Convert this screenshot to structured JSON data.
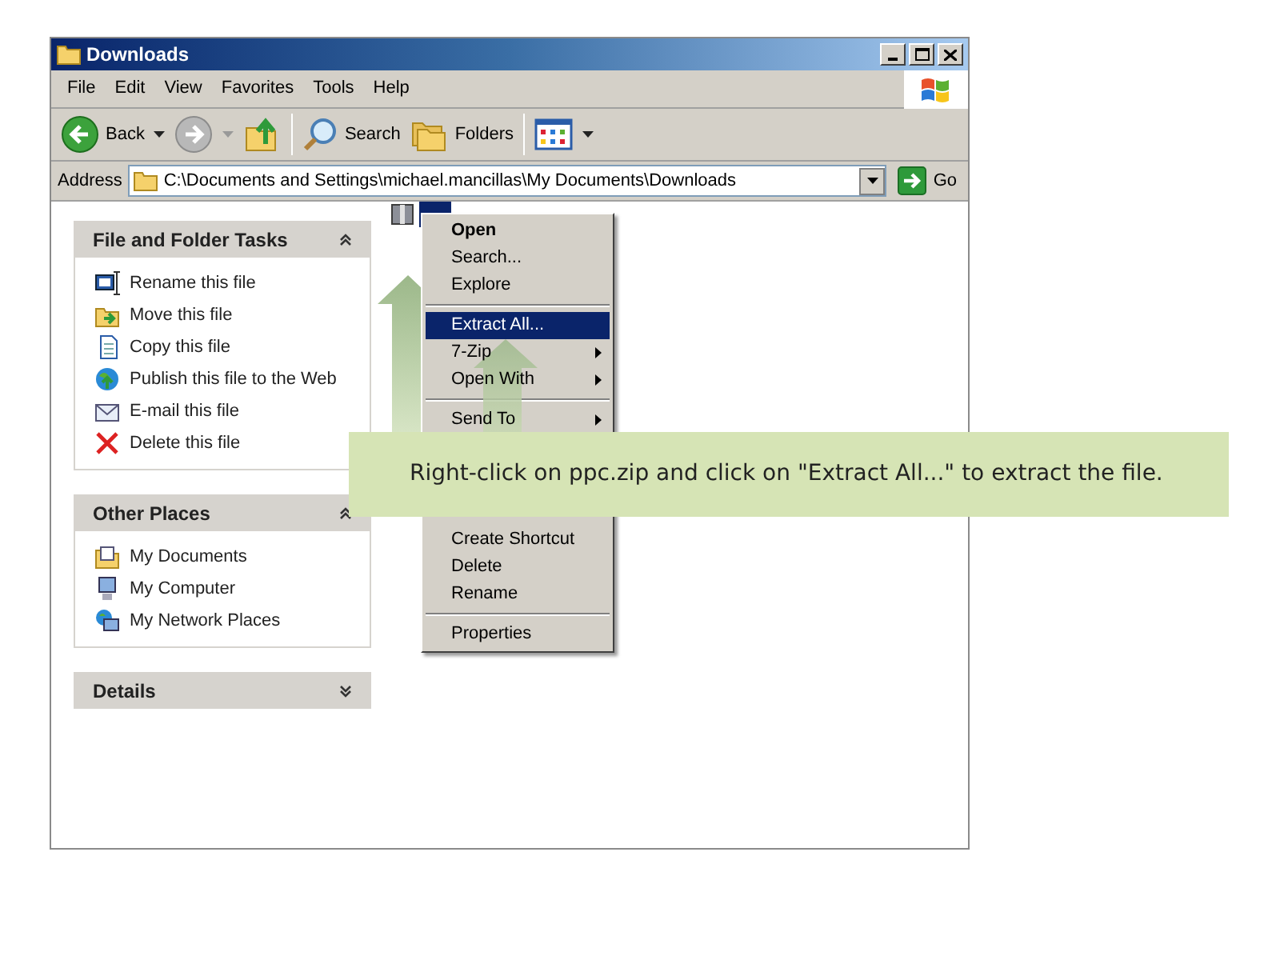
{
  "window": {
    "title": "Downloads"
  },
  "menu_bar": [
    "File",
    "Edit",
    "View",
    "Favorites",
    "Tools",
    "Help"
  ],
  "toolbar": [
    {
      "kind": "back",
      "label": "Back"
    },
    {
      "kind": "forward"
    },
    {
      "kind": "up"
    },
    {
      "kind": "search",
      "label": "Search"
    },
    {
      "kind": "folders",
      "label": "Folders"
    },
    {
      "kind": "views"
    }
  ],
  "address": {
    "label": "Address",
    "value": "C:\\Documents and Settings\\michael.mancillas\\My Documents\\Downloads",
    "go": "Go"
  },
  "panels": [
    {
      "title": "File and Folder Tasks",
      "expanded": true,
      "items": [
        {
          "kind": "rename",
          "label": "Rename this file"
        },
        {
          "kind": "move",
          "label": "Move this file"
        },
        {
          "kind": "copy",
          "label": "Copy this file"
        },
        {
          "kind": "publish",
          "label": "Publish this file to the Web"
        },
        {
          "kind": "email",
          "label": "E-mail this file"
        },
        {
          "kind": "delete",
          "label": "Delete this file"
        }
      ]
    },
    {
      "title": "Other Places",
      "expanded": true,
      "items": [
        {
          "kind": "documents",
          "label": "My Documents"
        },
        {
          "kind": "computer",
          "label": "My Computer"
        },
        {
          "kind": "network",
          "label": "My Network Places"
        }
      ]
    },
    {
      "title": "Details",
      "expanded": false
    }
  ],
  "context_menu": {
    "top": [
      {
        "kind": "item",
        "label": "Open",
        "default": true,
        "selected": false,
        "submenu": false
      },
      {
        "kind": "item",
        "label": "Search...",
        "default": false,
        "selected": false,
        "submenu": false
      },
      {
        "kind": "item",
        "label": "Explore",
        "default": false,
        "selected": false,
        "submenu": false
      },
      {
        "kind": "separator"
      },
      {
        "kind": "item",
        "label": "Extract All...",
        "default": false,
        "selected": true,
        "submenu": false
      },
      {
        "kind": "item",
        "label": "7-Zip",
        "default": false,
        "selected": false,
        "submenu": true
      },
      {
        "kind": "item",
        "label": "Open With",
        "default": false,
        "selected": false,
        "submenu": true
      },
      {
        "kind": "separator"
      },
      {
        "kind": "item",
        "label": "Send To",
        "default": false,
        "selected": false,
        "submenu": true
      }
    ],
    "bottom": [
      {
        "kind": "item",
        "label": "Create Shortcut",
        "default": false,
        "selected": false,
        "submenu": false
      },
      {
        "kind": "item",
        "label": "Delete",
        "default": false,
        "selected": false,
        "submenu": false
      },
      {
        "kind": "item",
        "label": "Rename",
        "default": false,
        "selected": false,
        "submenu": false
      },
      {
        "kind": "separator"
      },
      {
        "kind": "item",
        "label": "Properties",
        "default": false,
        "selected": false,
        "submenu": false
      }
    ]
  },
  "callout": {
    "text": "Right-click on ppc.zip and click on \"Extract All...\" to extract the file."
  }
}
